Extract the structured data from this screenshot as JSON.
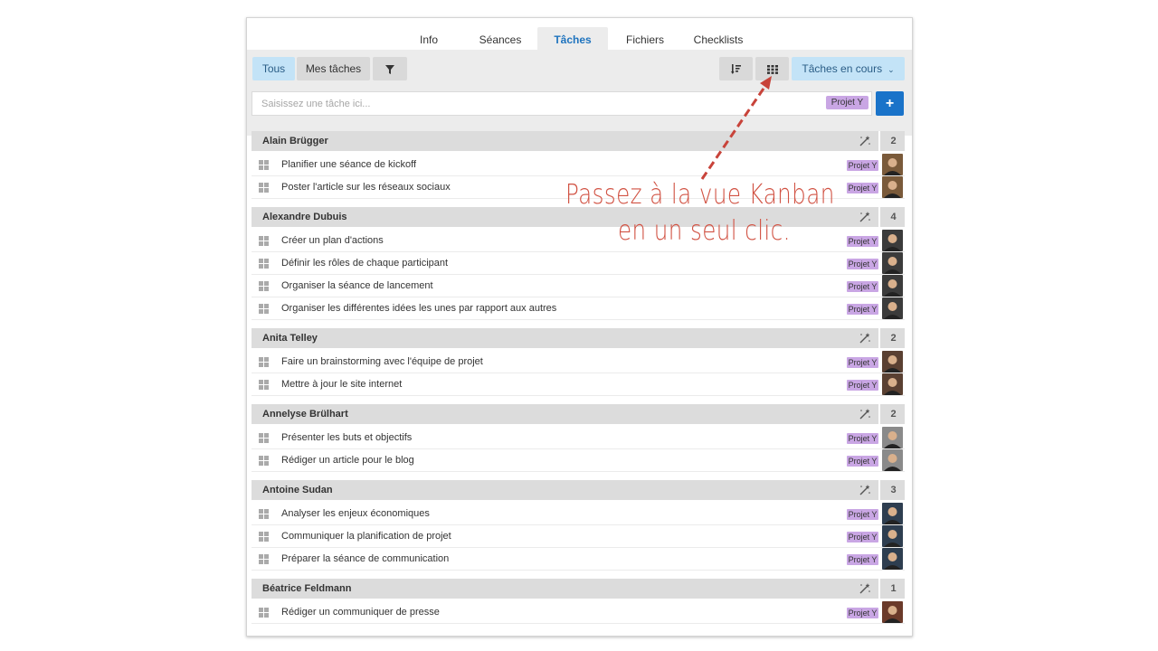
{
  "tabs": [
    {
      "label": "Info"
    },
    {
      "label": "Séances"
    },
    {
      "label": "Tâches"
    },
    {
      "label": "Fichiers"
    },
    {
      "label": "Checklists"
    }
  ],
  "active_tab": "Tâches",
  "toolbar": {
    "all_label": "Tous",
    "my_tasks_label": "Mes tâches",
    "status_label": "Tâches en cours"
  },
  "new_task": {
    "placeholder": "Saisissez une tâche ici...",
    "project_tag": "Projet Y",
    "add_label": "+"
  },
  "callout": {
    "line1": "Passez à la vue Kanban",
    "line2": "en un seul clic."
  },
  "colors": {
    "accent": "#1a73c9",
    "tag": "#c9a6e4",
    "annotation": "#d15243"
  },
  "groups": [
    {
      "name": "Alain Brügger",
      "count": "2",
      "tasks": [
        {
          "label": "Planifier une séance de kickoff",
          "tag": "Projet Y"
        },
        {
          "label": "Poster l'article sur les réseaux sociaux",
          "tag": "Projet Y"
        }
      ]
    },
    {
      "name": "Alexandre Dubuis",
      "count": "4",
      "tasks": [
        {
          "label": "Créer un plan d'actions",
          "tag": "Projet Y"
        },
        {
          "label": "Définir les rôles de chaque participant",
          "tag": "Projet Y"
        },
        {
          "label": "Organiser la séance de lancement",
          "tag": "Projet Y"
        },
        {
          "label": "Organiser les différentes idées les unes par rapport aux autres",
          "tag": "Projet Y"
        }
      ]
    },
    {
      "name": "Anita Telley",
      "count": "2",
      "tasks": [
        {
          "label": "Faire un brainstorming avec l'équipe de projet",
          "tag": "Projet Y"
        },
        {
          "label": "Mettre à jour le site internet",
          "tag": "Projet Y"
        }
      ]
    },
    {
      "name": "Annelyse Brülhart",
      "count": "2",
      "tasks": [
        {
          "label": "Présenter les buts et objectifs",
          "tag": "Projet Y"
        },
        {
          "label": "Rédiger un article pour le blog",
          "tag": "Projet Y"
        }
      ]
    },
    {
      "name": "Antoine Sudan",
      "count": "3",
      "tasks": [
        {
          "label": "Analyser les enjeux économiques",
          "tag": "Projet Y"
        },
        {
          "label": "Communiquer la planification de projet",
          "tag": "Projet Y"
        },
        {
          "label": "Préparer la séance de communication",
          "tag": "Projet Y"
        }
      ]
    },
    {
      "name": "Béatrice Feldmann",
      "count": "1",
      "tasks": [
        {
          "label": "Rédiger un communiquer de presse",
          "tag": "Projet Y"
        }
      ]
    }
  ]
}
